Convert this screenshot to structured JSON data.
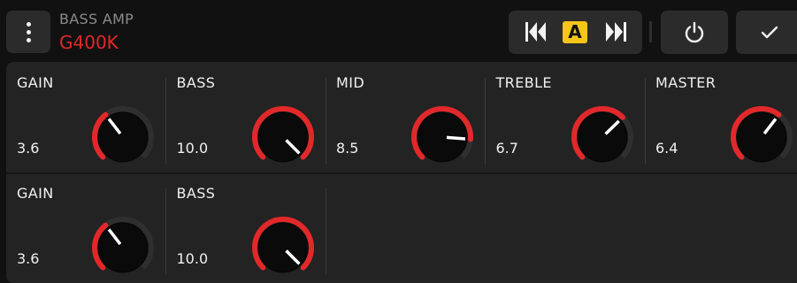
{
  "header": {
    "type_label": "BASS AMP",
    "model_name": "G400K",
    "ab_label": "A"
  },
  "colors": {
    "accent_red": "#e2282a",
    "badge_yellow": "#f5c518",
    "panel_bg": "#232323",
    "button_bg": "#2b2b2b"
  },
  "icons": {
    "menu": "vertical-dots-icon",
    "prev": "double-left-arrow-icon",
    "next": "double-right-arrow-icon",
    "power": "power-icon",
    "confirm": "checkmark-icon"
  },
  "params_row1": [
    {
      "label": "GAIN",
      "value": "3.6",
      "level": 0.36
    },
    {
      "label": "BASS",
      "value": "10.0",
      "level": 1.0
    },
    {
      "label": "MID",
      "value": "8.5",
      "level": 0.85
    },
    {
      "label": "TREBLE",
      "value": "6.7",
      "level": 0.67
    },
    {
      "label": "MASTER",
      "value": "6.4",
      "level": 0.64
    }
  ],
  "params_row2": [
    {
      "label": "GAIN",
      "value": "3.6",
      "level": 0.36
    },
    {
      "label": "BASS",
      "value": "10.0",
      "level": 1.0
    }
  ]
}
